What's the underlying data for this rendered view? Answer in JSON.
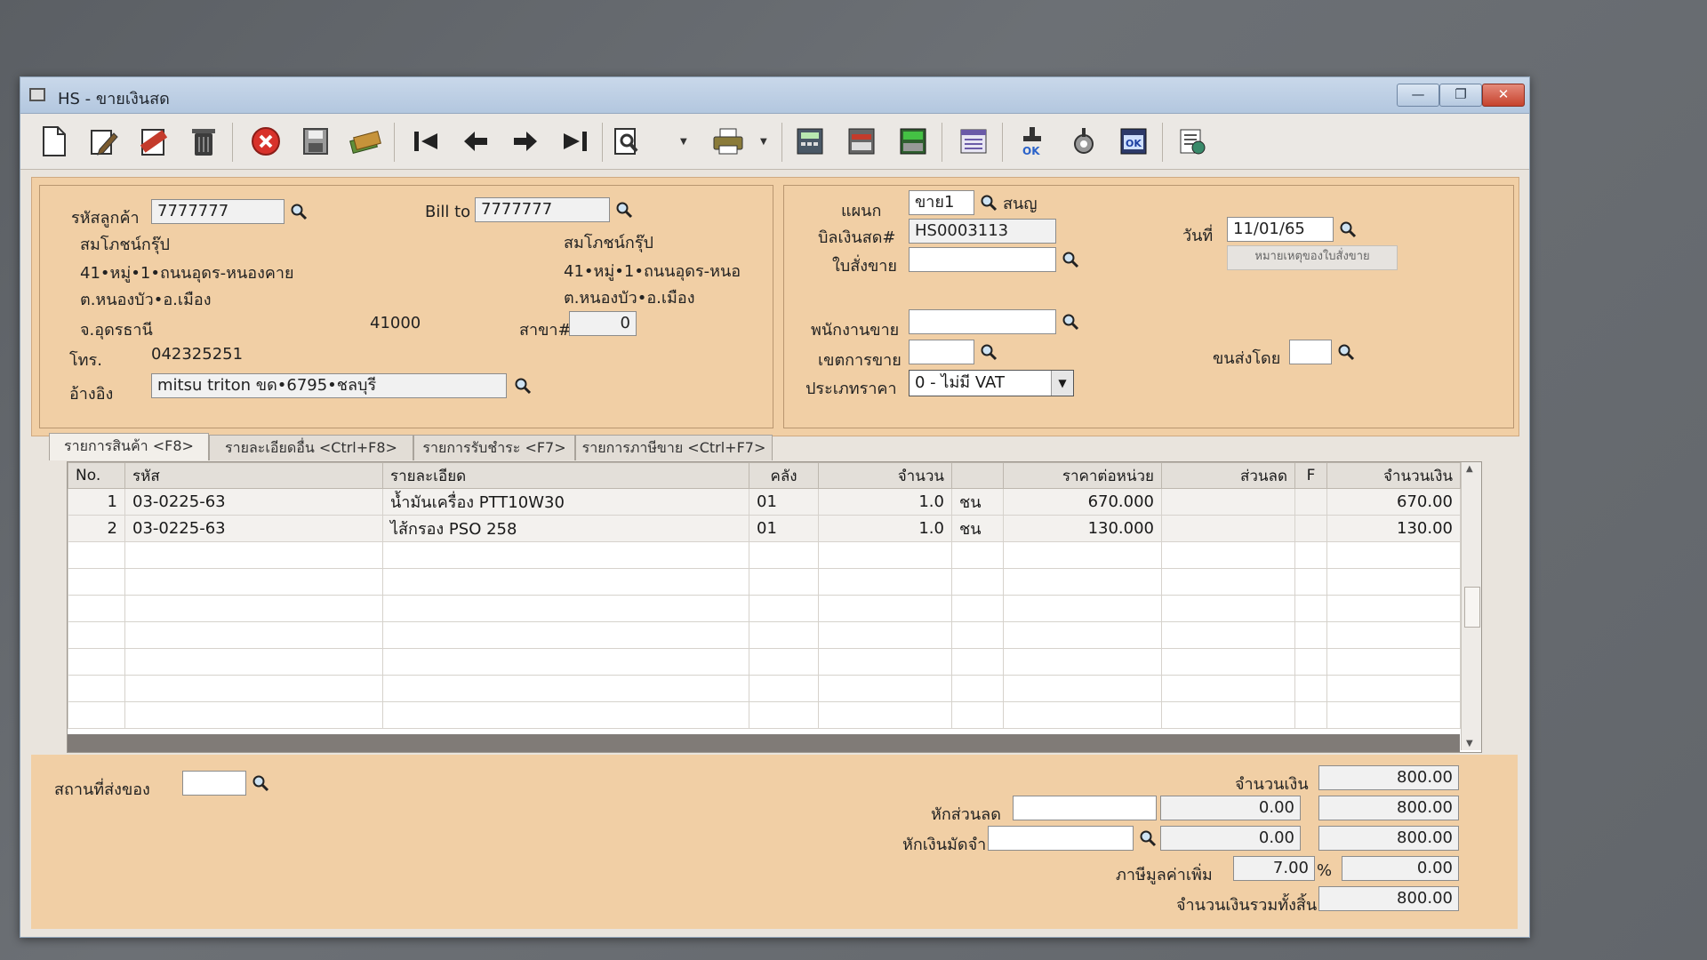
{
  "window": {
    "title": "HS - ขายเงินสด",
    "minimize": "—",
    "maximize": "❐",
    "close": "✕"
  },
  "toolbar": {
    "buttons": [
      "new-doc-icon",
      "edit-icon",
      "void-icon",
      "delete-bin-icon",
      "cancel-icon",
      "save-icon",
      "money-icon",
      "first-record-icon",
      "previous-record-icon",
      "next-record-icon",
      "last-record-icon",
      "search-doc-icon",
      "print-icon",
      "calculator-icon",
      "report-icon",
      "sum-icon",
      "document-list-icon",
      "approve-ok-icon",
      "tools-icon",
      "check-ok-icon",
      "settings-icon"
    ]
  },
  "customer": {
    "code_label": "รหัสลูกค้า",
    "code": "7777777",
    "name": "สมโภชน์กรุ๊ป",
    "address1": "41•หมู่•1•ถนนอุดร-หนองคาย",
    "address2": "ต.หนองบัว•อ.เมือง",
    "province": "จ.อุดรธานี",
    "zipcode": "41000",
    "phone_label": "โทร.",
    "phone": "042325251",
    "ref_label": "อ้างอิง",
    "ref": "mitsu triton ขด•6795•ชลบุรี"
  },
  "billto": {
    "label": "Bill to",
    "code": "7777777",
    "name": "สมโภชน์กรุ๊ป",
    "address1": "41•หมู่•1•ถนนอุดร-หนอ",
    "address2": "ต.หนองบัว•อ.เมือง",
    "branch_label": "สาขา#",
    "branch": "0"
  },
  "doc": {
    "dept_label": "แผนก",
    "dept": "ขาย1",
    "dept_name": "สนญ",
    "bill_label": "บิลเงินสด#",
    "bill": "HS0003113",
    "date_label": "วันที่",
    "date": "11/01/65",
    "order_label": "ใบสั่งขาย",
    "order": "",
    "order_note_button": "หมายเหตุของใบสั่งขาย",
    "salesman_label": "พนักงานขาย",
    "salesman": "",
    "area_label": "เขตการขาย",
    "area": "",
    "ship_label": "ขนส่งโดย",
    "ship": "",
    "pricetype_label": "ประเภทราคา",
    "pricetype": "0 - ไม่มี VAT"
  },
  "tabs": [
    "รายการสินค้า <F8>",
    "รายละเอียดอื่น <Ctrl+F8>",
    "รายการรับชำระ <F7>",
    "รายการภาษีขาย <Ctrl+F7>"
  ],
  "grid": {
    "headers": [
      "No.",
      "รหัส",
      "รายละเอียด",
      "คลัง",
      "จำนวน",
      "",
      "ราคาต่อหน่วย",
      "ส่วนลด",
      "F",
      "จำนวนเงิน"
    ],
    "rows": [
      [
        "1",
        "03-0225-63",
        "น้ำมันเครื่อง PTT10W30",
        "01",
        "1.0",
        "ชน",
        "670.000",
        "",
        "",
        "670.00"
      ],
      [
        "2",
        "03-0225-63",
        "ไส้กรอง PSO 258",
        "01",
        "1.0",
        "ชน",
        "130.000",
        "",
        "",
        "130.00"
      ]
    ]
  },
  "footer": {
    "delivery_label": "สถานที่ส่งของ",
    "delivery": "",
    "amount_label": "จำนวนเงิน",
    "amount": "800.00",
    "discount_label": "หักส่วนลด",
    "discount_text": "",
    "discount": "0.00",
    "after_discount": "800.00",
    "deposit_label": "หักเงินมัดจำ",
    "deposit_text": "",
    "deposit": "0.00",
    "after_deposit": "800.00",
    "vat_label": "ภาษีมูลค่าเพิ่ม",
    "vat_rate": "7.00",
    "vat_unit": "%",
    "vat": "0.00",
    "total_label": "จำนวนเงินรวมทั้งสิ้น",
    "total": "800.00"
  }
}
